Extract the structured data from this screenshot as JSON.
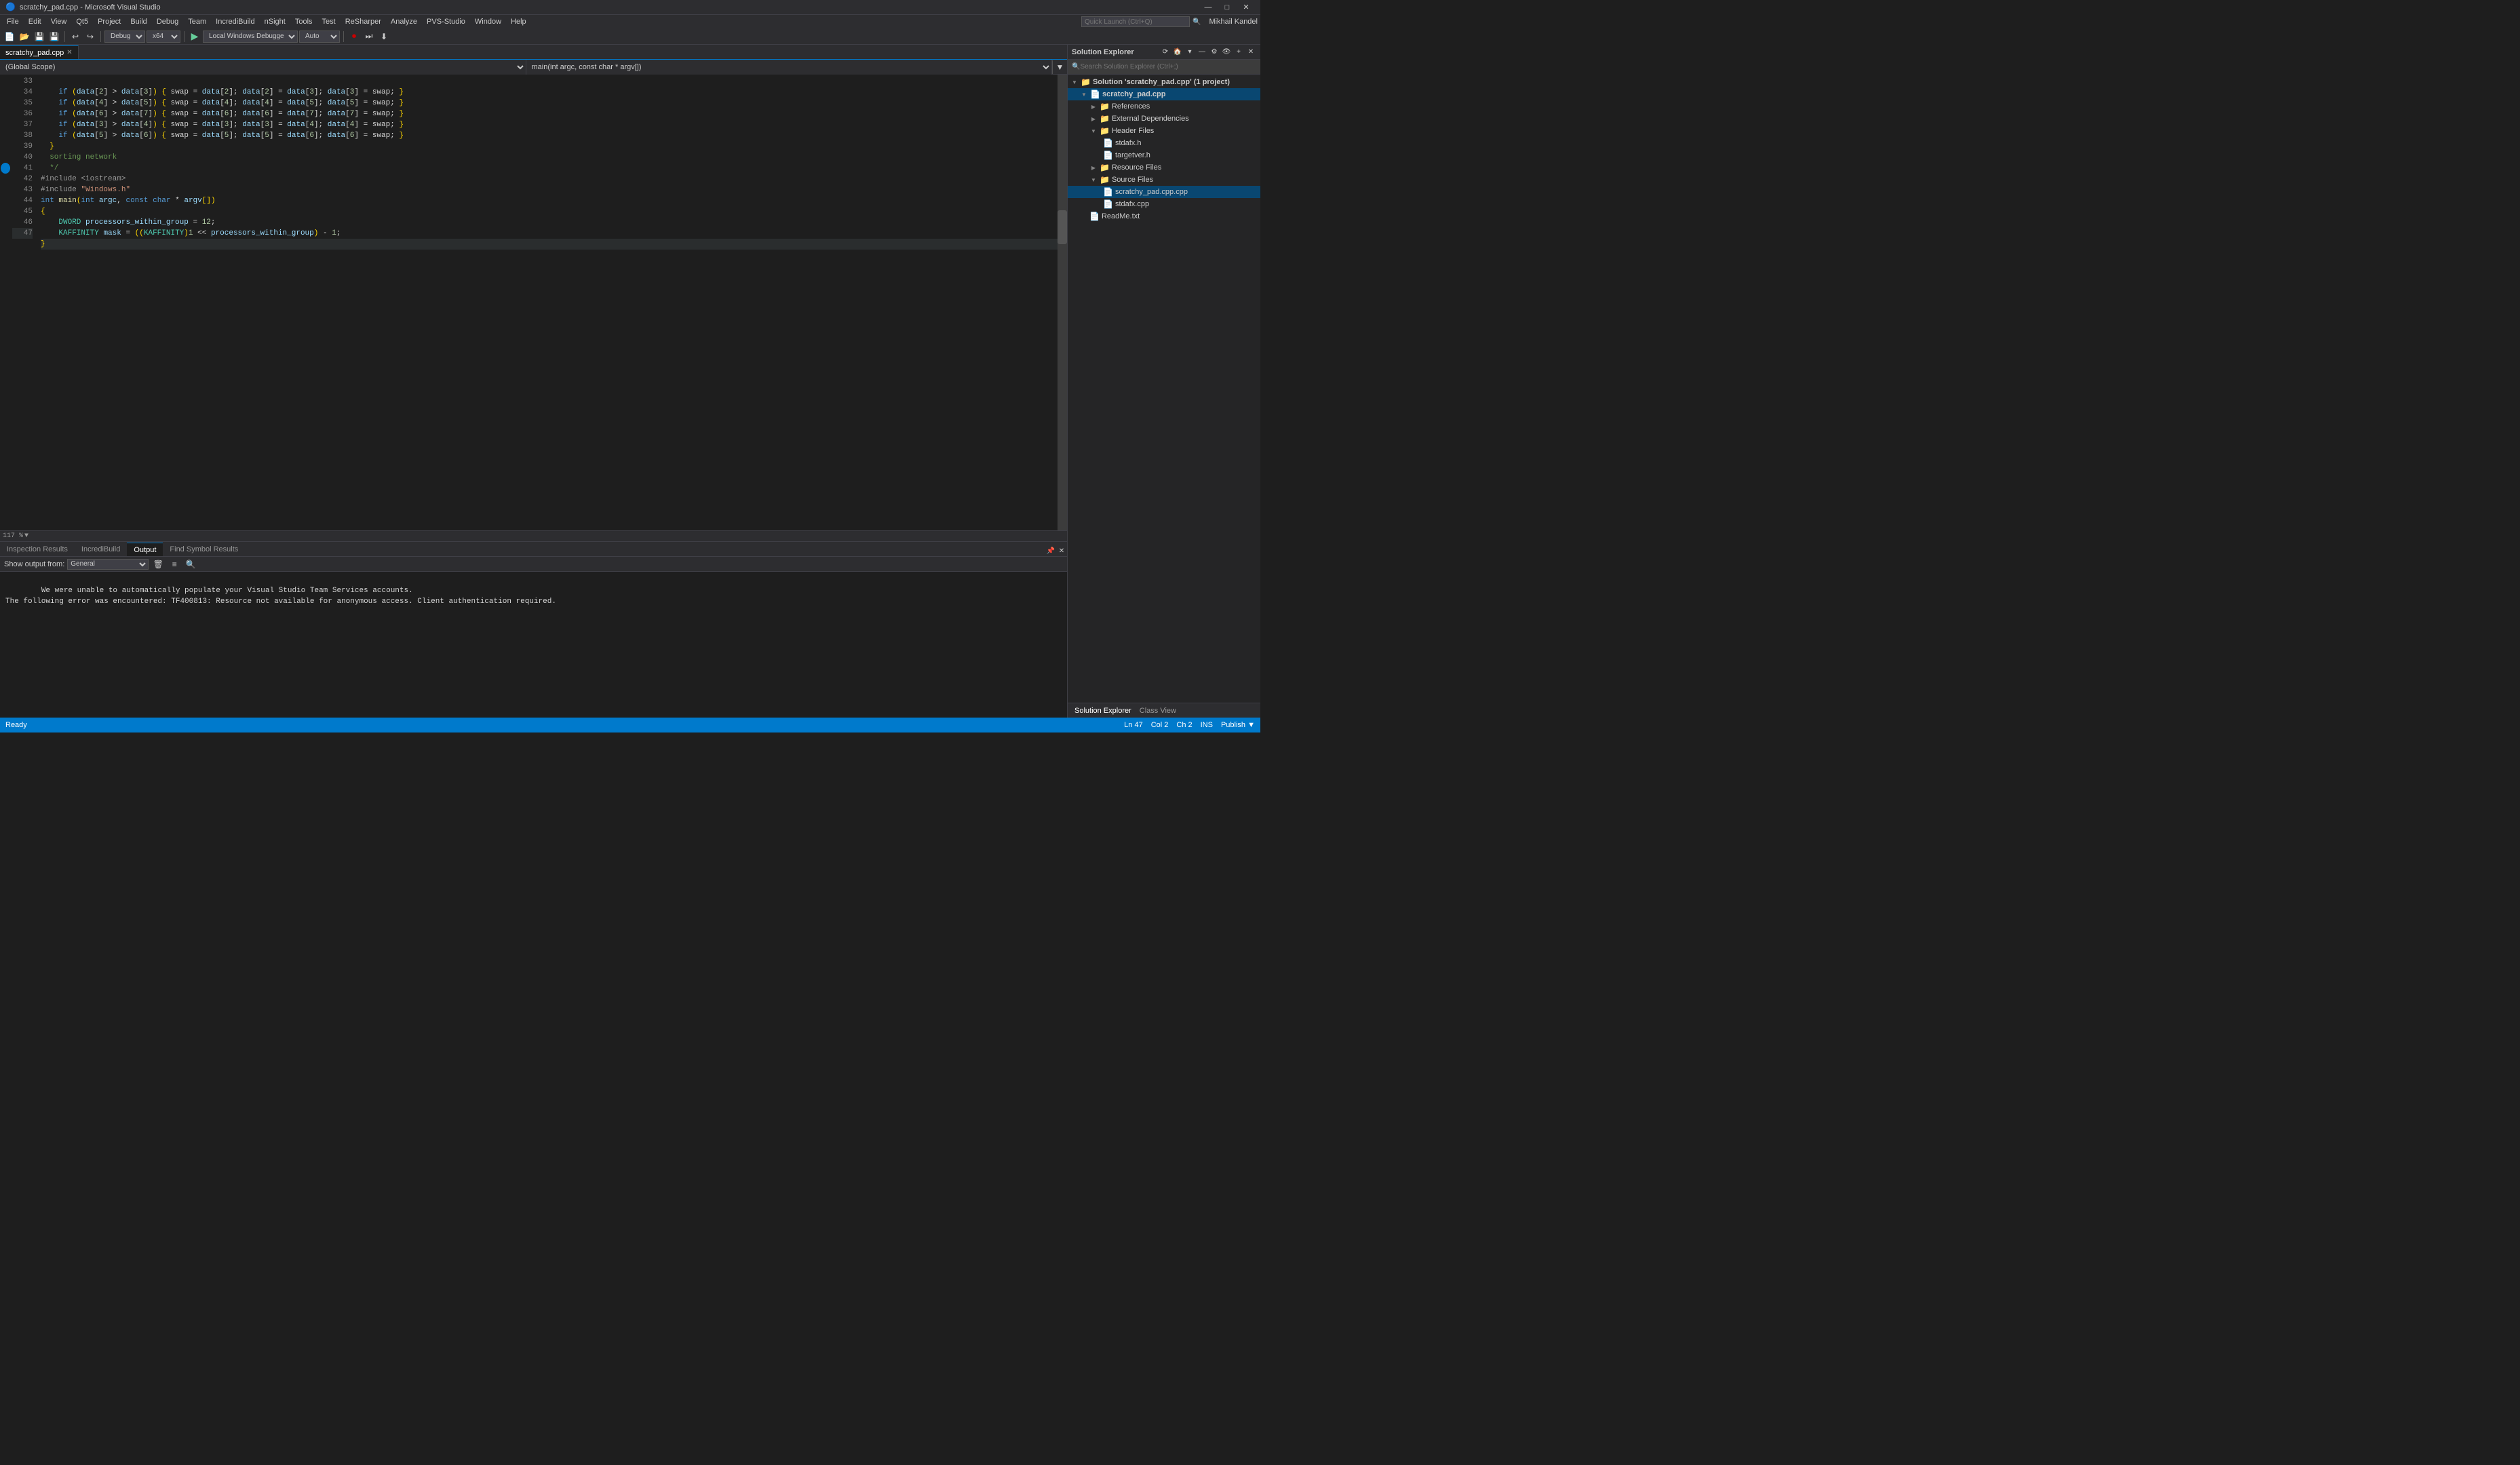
{
  "title": {
    "text": "scratchy_pad.cpp - Microsoft Visual Studio",
    "icon": "▶"
  },
  "window_controls": {
    "minimize": "—",
    "maximize": "□",
    "close": "✕"
  },
  "menu": {
    "items": [
      "File",
      "Edit",
      "View",
      "Qt5",
      "Project",
      "Build",
      "Debug",
      "Team",
      "IncrediBuild",
      "nSight",
      "Tools",
      "Test",
      "ReSharper",
      "Analyze",
      "PVS-Studio",
      "Window",
      "Help"
    ]
  },
  "quick_launch": {
    "placeholder": "Quick Launch (Ctrl+Q)"
  },
  "toolbar": {
    "config_options": [
      "Debug"
    ],
    "platform_options": [
      "x64"
    ],
    "attach_options": [
      "Local Windows Debugger"
    ],
    "format_options": [
      "Auto"
    ]
  },
  "tab": {
    "name": "scratchy_pad.cpp",
    "active": true
  },
  "nav_bar": {
    "left": "(Global Scope)",
    "right": "main(int argc, const char * argv[])"
  },
  "code_lines": [
    {
      "num": 33,
      "content": "    if (data[2] > data[3]) { swap = data[2]; data[2] = data[3]; data[3] = swap; }"
    },
    {
      "num": 34,
      "content": "    if (data[4] > data[5]) { swap = data[4]; data[4] = data[5]; data[5] = swap; }"
    },
    {
      "num": 35,
      "content": "    if (data[6] > data[7]) { swap = data[6]; data[6] = data[7]; data[7] = swap; }"
    },
    {
      "num": 36,
      "content": "    if (data[3] > data[4]) { swap = data[3]; data[3] = data[4]; data[4] = swap; }"
    },
    {
      "num": 37,
      "content": "    if (data[5] > data[6]) { swap = data[5]; data[5] = data[6]; data[6] = swap; }"
    },
    {
      "num": 38,
      "content": "  }"
    },
    {
      "num": 39,
      "content": "  sorting network"
    },
    {
      "num": 40,
      "content": "  */"
    },
    {
      "num": 41,
      "content": "#include <iostream>"
    },
    {
      "num": 42,
      "content": "#include \"Windows.h\""
    },
    {
      "num": 43,
      "content": "int main(int argc, const char * argv[])"
    },
    {
      "num": 44,
      "content": "{"
    },
    {
      "num": 45,
      "content": "    DWORD processors_within_group = 12;"
    },
    {
      "num": 46,
      "content": "    KAFFINITY mask = ((KAFFINITY)1 << processors_within_group) - 1;"
    },
    {
      "num": 47,
      "content": "}"
    }
  ],
  "zoom": {
    "level": "117 %"
  },
  "panel": {
    "tabs": [
      {
        "label": "Inspection Results",
        "active": false
      },
      {
        "label": "IncrediBuild",
        "active": false
      },
      {
        "label": "Output",
        "active": true
      },
      {
        "label": "Find Symbol Results",
        "active": false
      }
    ],
    "output_label": "Show output from:",
    "output_source": "General",
    "content": "We were unable to automatically populate your Visual Studio Team Services accounts.\nThe following error was encountered: TF400813: Resource not available for anonymous access. Client authentication required."
  },
  "solution_explorer": {
    "title": "Solution Explorer",
    "search_placeholder": "Search Solution Explorer (Ctrl+;)",
    "tree": {
      "solution": "Solution 'scratchy_pad.cpp' (1 project)",
      "project": "scratchy_pad.cpp",
      "nodes": [
        {
          "label": "References",
          "indent": 2,
          "icon": "📁",
          "expanded": false
        },
        {
          "label": "External Dependencies",
          "indent": 2,
          "icon": "📁",
          "expanded": false
        },
        {
          "label": "Header Files",
          "indent": 2,
          "icon": "📁",
          "expanded": true,
          "children": [
            {
              "label": "stdafx.h",
              "indent": 3,
              "icon": "📄"
            },
            {
              "label": "targetver.h",
              "indent": 3,
              "icon": "📄"
            }
          ]
        },
        {
          "label": "Resource Files",
          "indent": 2,
          "icon": "📁",
          "expanded": false
        },
        {
          "label": "Source Files",
          "indent": 2,
          "icon": "📁",
          "expanded": true,
          "children": [
            {
              "label": "scratchy_pad.cpp.cpp",
              "indent": 3,
              "icon": "📄",
              "selected": true
            },
            {
              "label": "stdafx.cpp",
              "indent": 3,
              "icon": "📄"
            }
          ]
        },
        {
          "label": "ReadMe.txt",
          "indent": 2,
          "icon": "📄"
        }
      ]
    }
  },
  "se_bottom_tabs": [
    {
      "label": "Solution Explorer",
      "active": true
    },
    {
      "label": "Class View",
      "active": false
    }
  ],
  "status_bar": {
    "ready": "Ready",
    "ln": "Ln 47",
    "col": "Col 2",
    "ch": "Ch 2",
    "ins": "INS",
    "user": "Mikhail Kandel",
    "publish": "Publish ▼"
  }
}
